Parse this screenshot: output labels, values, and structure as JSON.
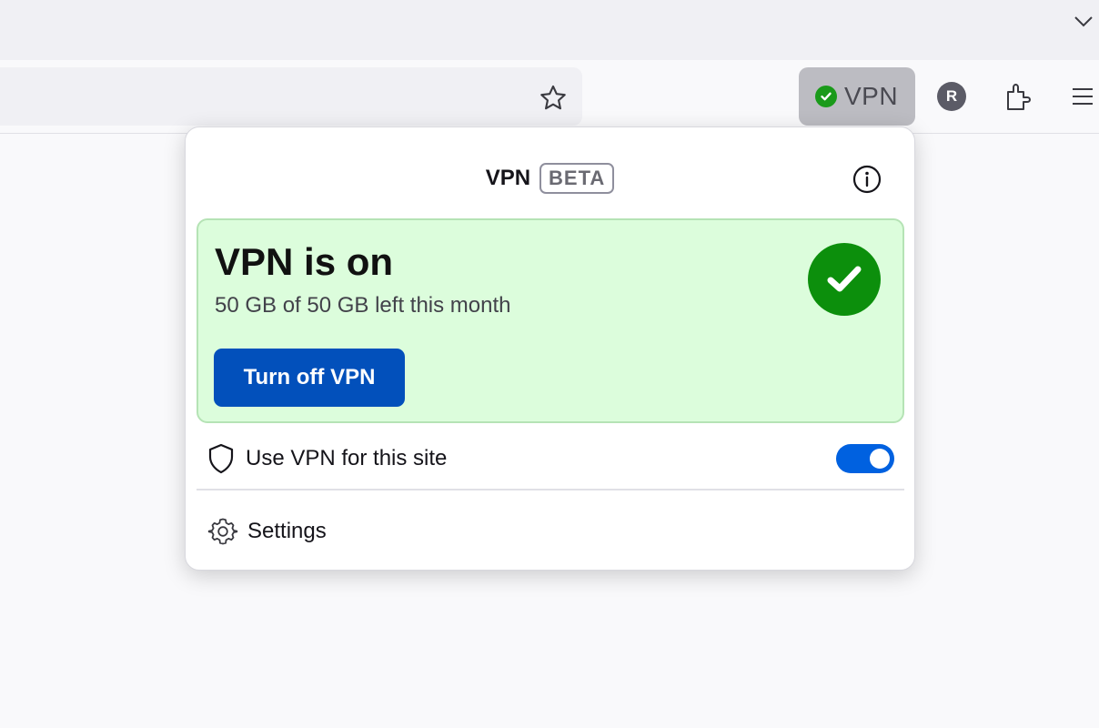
{
  "toolbar": {
    "vpn_button_label": "VPN",
    "avatar_initial": "R"
  },
  "panel": {
    "title": "VPN",
    "badge": "BETA",
    "status": {
      "title": "VPN is on",
      "subtitle": "50 GB of 50 GB left this month",
      "action_label": "Turn off VPN",
      "check_color": "#0c8f0c",
      "background_color": "#dcfddc"
    },
    "site_toggle": {
      "label": "Use VPN for this site",
      "enabled": true
    },
    "settings_label": "Settings"
  },
  "colors": {
    "accent": "#0061e0",
    "primary_button": "#0250bb"
  }
}
